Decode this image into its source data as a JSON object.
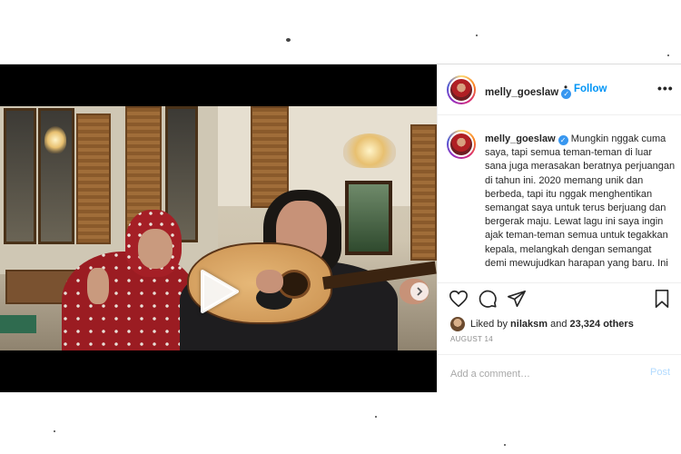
{
  "post": {
    "username": "melly_goeslaw",
    "verified_icon": "verified-badge-icon",
    "follow_label": "Follow",
    "separator": "•",
    "more_label": "•••",
    "caption_text": "Mungkin nggak cuma saya, tapi semua teman-teman di luar sana juga merasakan beratnya perjuangan di tahun ini. 2020 memang unik dan berbeda, tapi itu nggak menghentikan semangat saya untuk terus berjuang dan bergerak maju. Lewat lagu ini saya ingin ajak teman-teman semua untuk tegakkan kepala, melangkah dengan semangat demi mewujudkan harapan yang baru. Ini",
    "liked_by_prefix": "Liked by",
    "liked_by_user": "nilaksm",
    "liked_by_and": "and",
    "liked_by_count": "23,324 others",
    "date": "AUGUST 14",
    "comment_placeholder": "Add a comment…",
    "post_label": "Post"
  },
  "colors": {
    "follow": "#0095f6",
    "verified": "#3897f0",
    "post_disabled": "#b3dbff",
    "muted": "#8e8e8e"
  },
  "icons": {
    "play": "play-icon",
    "next": "chevron-right-icon",
    "like": "heart-icon",
    "comment": "comment-icon",
    "share": "paper-plane-icon",
    "save": "bookmark-icon"
  }
}
